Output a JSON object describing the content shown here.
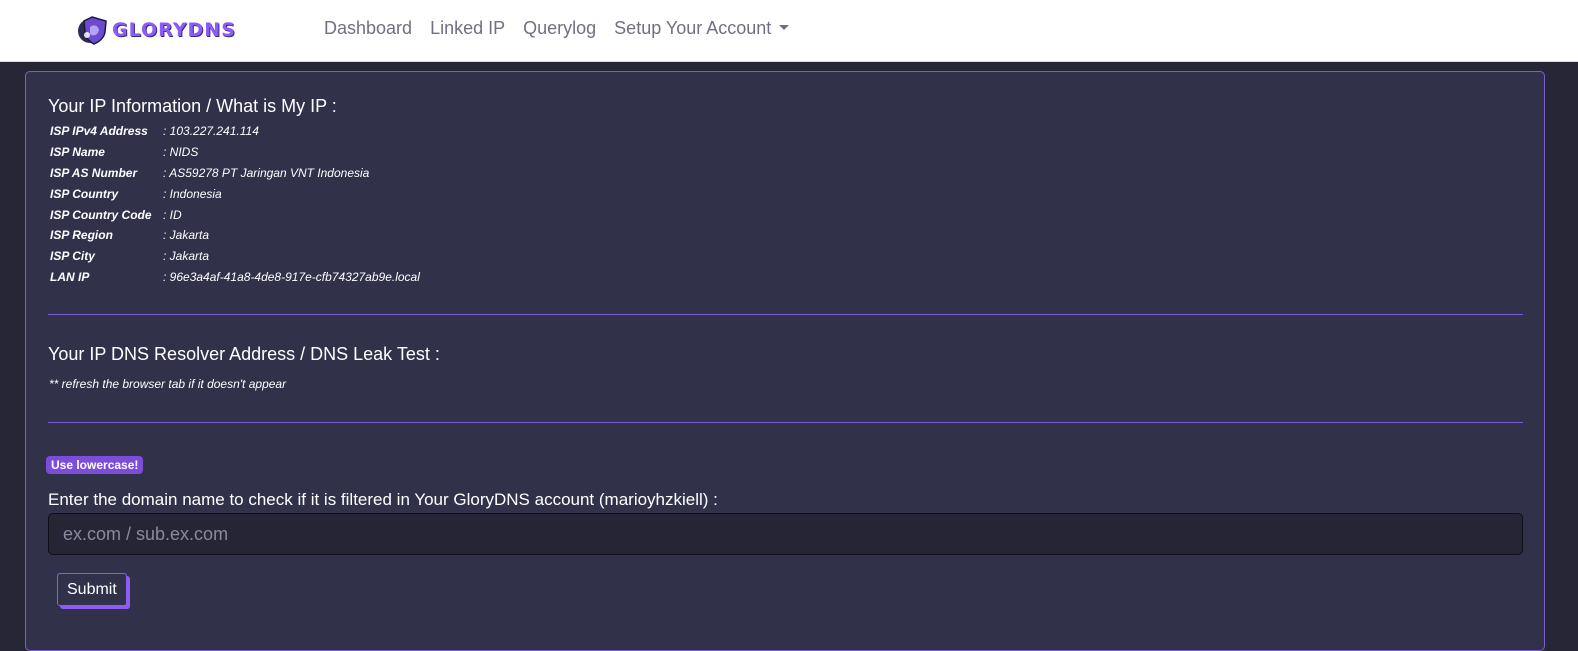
{
  "brand": {
    "name": "GLORYDNS"
  },
  "nav": {
    "dashboard": "Dashboard",
    "linked_ip": "Linked IP",
    "querylog": "Querylog",
    "setup": "Setup Your Account"
  },
  "ip_info": {
    "title": "Your IP Information / What is My IP :",
    "rows": [
      {
        "label": "ISP IPv4 Address",
        "value": ": 103.227.241.114"
      },
      {
        "label": "ISP Name",
        "value": ": NIDS"
      },
      {
        "label": "ISP AS Number",
        "value": ": AS59278 PT Jaringan VNT Indonesia"
      },
      {
        "label": "ISP Country",
        "value": ": Indonesia"
      },
      {
        "label": "ISP Country Code",
        "value": ": ID"
      },
      {
        "label": "ISP Region",
        "value": ": Jakarta"
      },
      {
        "label": "ISP City",
        "value": ": Jakarta"
      },
      {
        "label": "LAN IP",
        "value": ": 96e3a4af-41a8-4de8-917e-cfb74327ab9e.local"
      }
    ]
  },
  "dns": {
    "title": "Your IP DNS Resolver Address / DNS Leak Test :",
    "note": "** refresh the browser tab if it doesn't appear"
  },
  "domain_check": {
    "badge": "Use lowercase!",
    "label": "Enter the domain name to check if it is filtered in Your GloryDNS account (marioyhzkiell) :",
    "placeholder": "ex.com / sub.ex.com",
    "value": "",
    "submit_label": "Submit"
  },
  "colors": {
    "accent": "#8b5cf6",
    "panel_bg": "#32314a",
    "page_bg": "#262637"
  }
}
